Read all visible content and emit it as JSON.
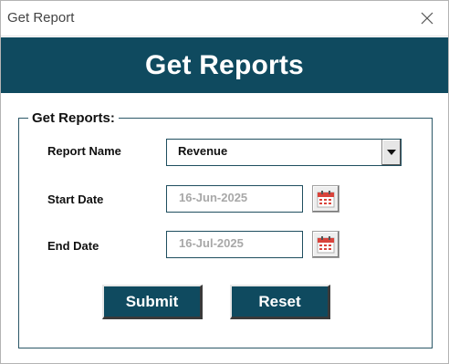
{
  "window": {
    "title": "Get Report"
  },
  "header": {
    "title": "Get Reports"
  },
  "group": {
    "legend": "Get Reports:"
  },
  "form": {
    "report_name_label": "Report Name",
    "report_name_value": "Revenue",
    "start_date_label": "Start Date",
    "start_date_value": "16-Jun-2025",
    "end_date_label": "End Date",
    "end_date_value": "16-Jul-2025"
  },
  "buttons": {
    "submit": "Submit",
    "reset": "Reset"
  },
  "colors": {
    "brand": "#0f4a5f",
    "calendar_accent": "#d9433b"
  },
  "icons": {
    "close": "close-icon",
    "dropdown": "dropdown-arrow-icon",
    "calendar": "calendar-icon"
  }
}
